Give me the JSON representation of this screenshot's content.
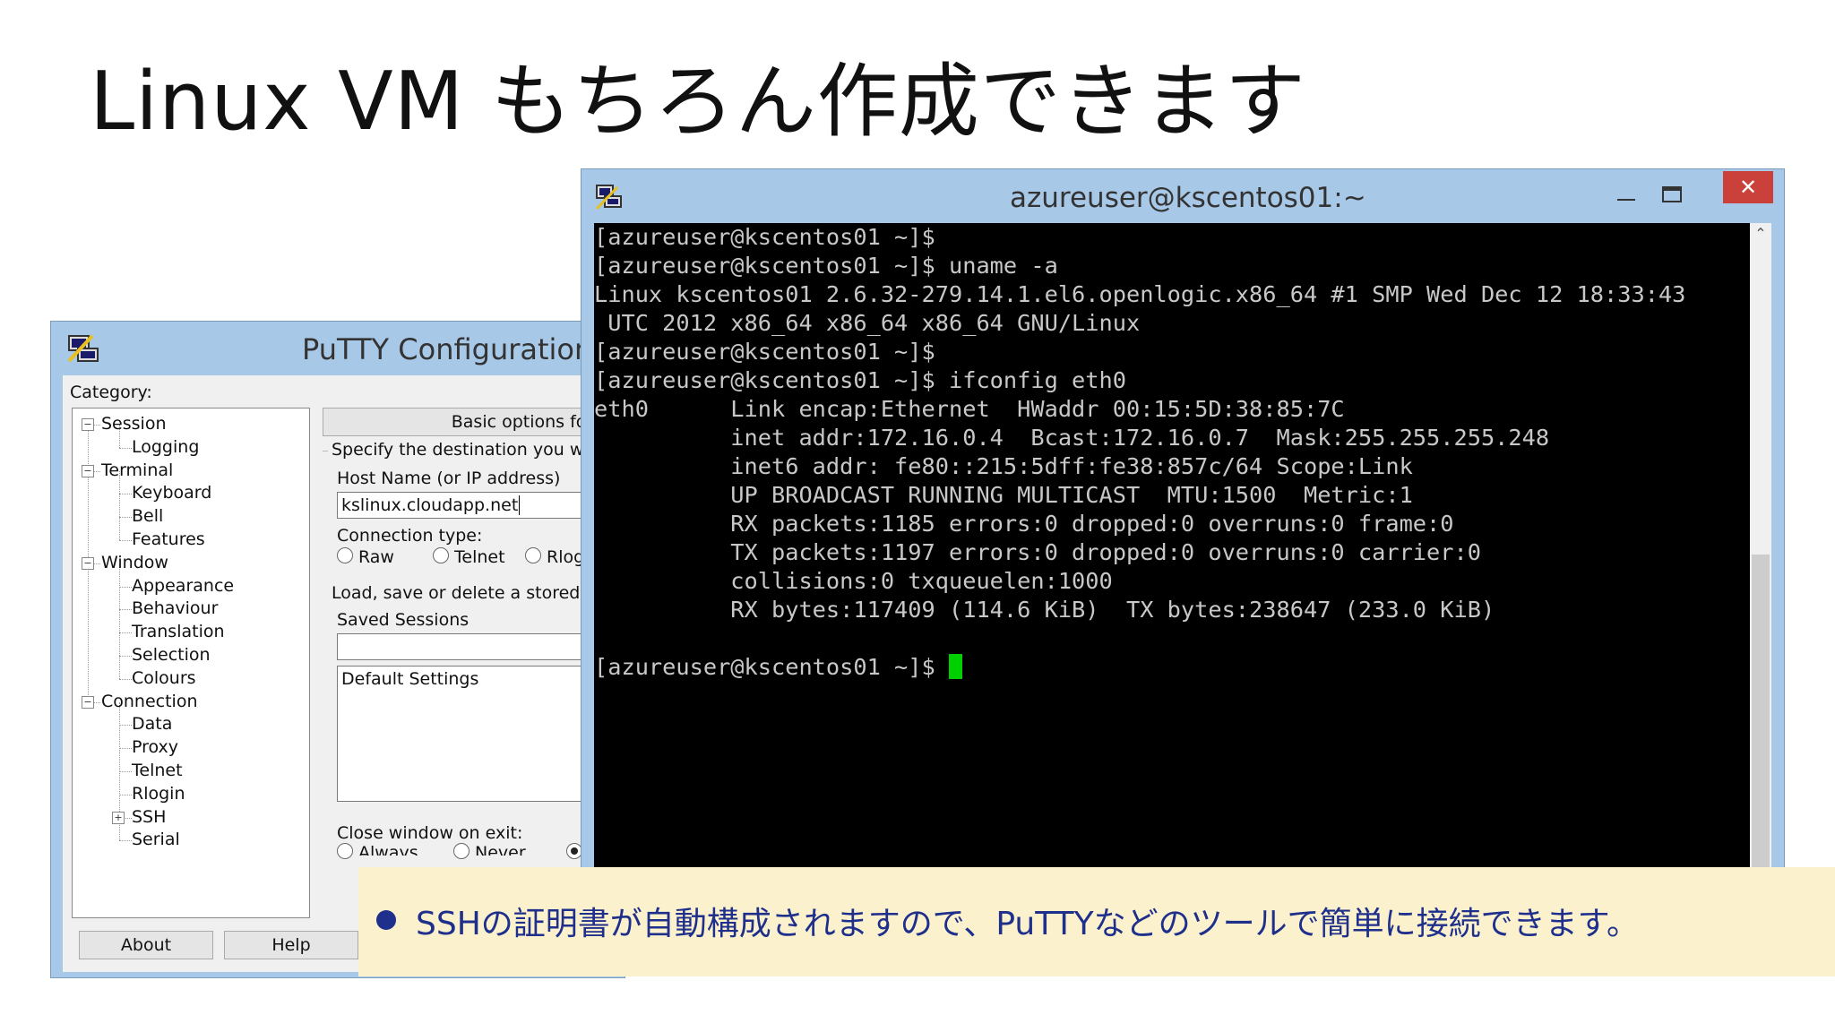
{
  "slide": {
    "title": "Linux VM もちろん作成できます"
  },
  "putty": {
    "title": "PuTTY Configuration",
    "category_label": "Category:",
    "tree": [
      "Session",
      "Logging",
      "Terminal",
      "Keyboard",
      "Bell",
      "Features",
      "Window",
      "Appearance",
      "Behaviour",
      "Translation",
      "Selection",
      "Colours",
      "Connection",
      "Data",
      "Proxy",
      "Telnet",
      "Rlogin",
      "SSH",
      "Serial"
    ],
    "panel_header": "Basic options for your",
    "specify_label": "Specify the destination you wa",
    "host_label": "Host Name (or IP address)",
    "host_value": "kslinux.cloudapp.net",
    "conn_type_label": "Connection type:",
    "conn_types": [
      "Raw",
      "Telnet",
      "Rlog"
    ],
    "load_save_label": "Load, save or delete a stored s",
    "saved_sessions_label": "Saved Sessions",
    "saved_session_input": "",
    "session_list": [
      "Default Settings"
    ],
    "close_label": "Close window on exit:",
    "close_options": [
      "Always",
      "Never"
    ],
    "about_button": "About",
    "help_button": "Help",
    "accent_color": "#a8c8e8"
  },
  "terminal": {
    "title": "azureuser@kscentos01:~",
    "close_glyph": "✕",
    "lines": [
      "[azureuser@kscentos01 ~]$",
      "[azureuser@kscentos01 ~]$ uname -a",
      "Linux kscentos01 2.6.32-279.14.1.el6.openlogic.x86_64 #1 SMP Wed Dec 12 18:33:43",
      " UTC 2012 x86_64 x86_64 x86_64 GNU/Linux",
      "[azureuser@kscentos01 ~]$",
      "[azureuser@kscentos01 ~]$ ifconfig eth0",
      "eth0      Link encap:Ethernet  HWaddr 00:15:5D:38:85:7C",
      "          inet addr:172.16.0.4  Bcast:172.16.0.7  Mask:255.255.255.248",
      "          inet6 addr: fe80::215:5dff:fe38:857c/64 Scope:Link",
      "          UP BROADCAST RUNNING MULTICAST  MTU:1500  Metric:1",
      "          RX packets:1185 errors:0 dropped:0 overruns:0 frame:0",
      "          TX packets:1197 errors:0 dropped:0 overruns:0 carrier:0",
      "          collisions:0 txqueuelen:1000",
      "          RX bytes:117409 (114.6 KiB)  TX bytes:238647 (233.0 KiB)",
      "",
      "[azureuser@kscentos01 ~]$ "
    ],
    "cursor_color": "#00d000"
  },
  "callout": {
    "text": "SSHの証明書が自動構成されますので、PuTTYなどのツールで簡単に接続できます。",
    "text_color": "#1f2f8c",
    "background": "#fbf2cd"
  }
}
